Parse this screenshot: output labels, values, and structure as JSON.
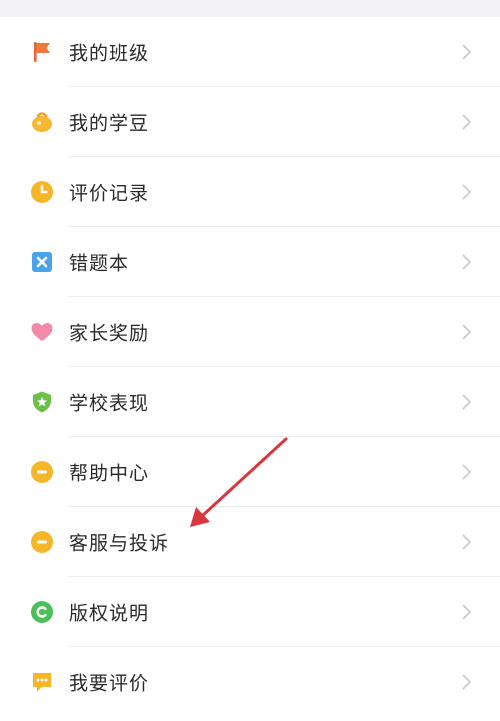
{
  "menu": {
    "items": [
      {
        "label": "我的班级",
        "icon": "flag-icon",
        "color": "#f07a3c"
      },
      {
        "label": "我的学豆",
        "icon": "bean-bag-icon",
        "color": "#f7b733"
      },
      {
        "label": "评价记录",
        "icon": "clock-icon",
        "color": "#f5b62a"
      },
      {
        "label": "错题本",
        "icon": "wrong-book-icon",
        "color": "#4aa3e8"
      },
      {
        "label": "家长奖励",
        "icon": "heart-icon",
        "color": "#f28aa8"
      },
      {
        "label": "学校表现",
        "icon": "shield-star-icon",
        "color": "#6cc04a"
      },
      {
        "label": "帮助中心",
        "icon": "help-face-icon",
        "color": "#f5b62a"
      },
      {
        "label": "客服与投诉",
        "icon": "service-face-icon",
        "color": "#f5b62a"
      },
      {
        "label": "版权说明",
        "icon": "copyright-icon",
        "color": "#4cbf59"
      },
      {
        "label": "我要评价",
        "icon": "comment-icon",
        "color": "#f5b62a"
      }
    ]
  },
  "annotation": {
    "arrow_color": "#d9363e",
    "points_to": "客服与投诉"
  }
}
